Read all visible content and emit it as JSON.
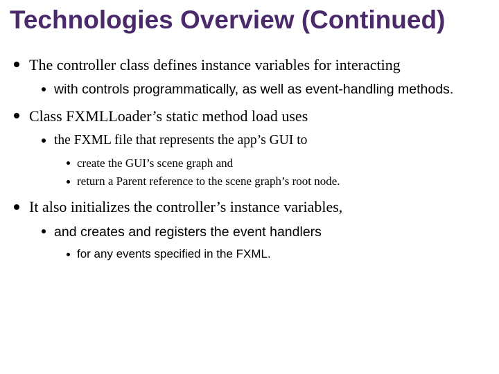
{
  "title": "Technologies Overview (Continued)",
  "bullets": {
    "b1": "The controller class defines instance variables for interacting",
    "b1a": "with controls programmatically, as well as event-handling methods.",
    "b2": "Class FXMLLoader’s static method load uses",
    "b2a": "the FXML file that represents the app’s GUI to",
    "b2a1": "create the GUI’s scene graph and",
    "b2a2": "return a Parent reference to the scene graph’s root node.",
    "b3": "It also initializes the controller’s instance variables,",
    "b3a": "and creates and registers the event handlers",
    "b3a1": "for any events specified in the FXML."
  }
}
